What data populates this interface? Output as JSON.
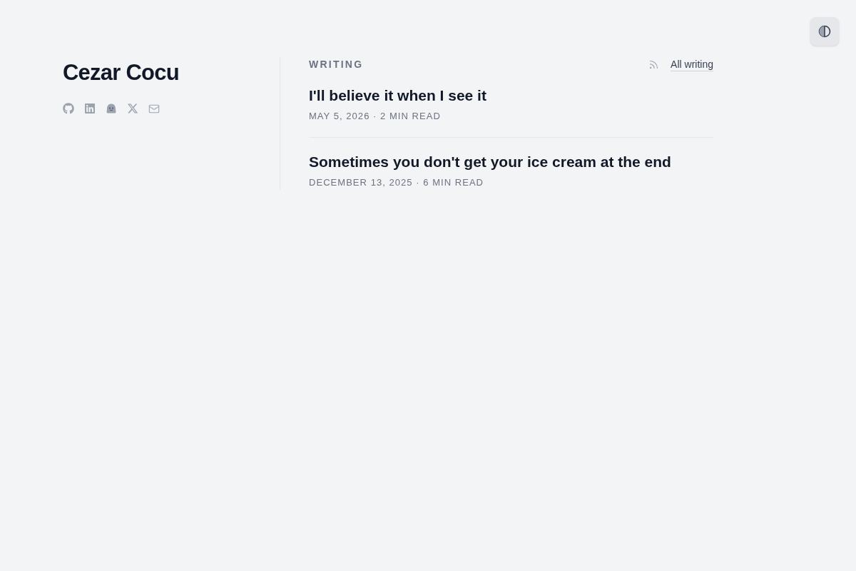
{
  "profile": {
    "name": "Cezar Cocu"
  },
  "writing": {
    "heading": "WRITING",
    "all_link": "All writing"
  },
  "posts": [
    {
      "title": "I'll believe it when I see it",
      "meta": "MAY 5, 2026 · 2 MIN READ"
    },
    {
      "title": "Sometimes you don't get your ice cream at the end",
      "meta": "DECEMBER 13, 2025 · 6 MIN READ"
    }
  ]
}
